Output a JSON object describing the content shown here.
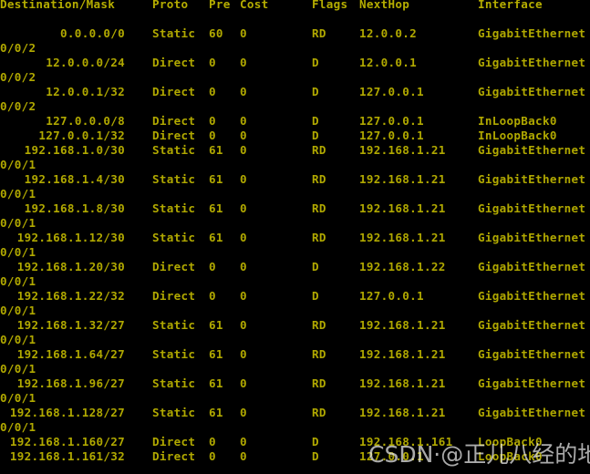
{
  "terminal": {
    "background_color": "#000000",
    "text_color": "#b0a800",
    "columns": {
      "destination": "Destination/Mask",
      "proto": "Proto",
      "pre": "Pre",
      "cost": "Cost",
      "flags": "Flags",
      "nexthop": "NextHop",
      "interface": "Interface"
    },
    "routes": [
      {
        "destination": "0.0.0.0/0",
        "proto": "Static",
        "pre": "60",
        "cost": "0",
        "flags": "RD",
        "nexthop": "12.0.0.2",
        "interface": "GigabitEthernet",
        "interface_wrap": "0/0/2"
      },
      {
        "destination": "12.0.0.0/24",
        "proto": "Direct",
        "pre": "0",
        "cost": "0",
        "flags": "D",
        "nexthop": "12.0.0.1",
        "interface": "GigabitEthernet",
        "interface_wrap": "0/0/2"
      },
      {
        "destination": "12.0.0.1/32",
        "proto": "Direct",
        "pre": "0",
        "cost": "0",
        "flags": "D",
        "nexthop": "127.0.0.1",
        "interface": "GigabitEthernet",
        "interface_wrap": "0/0/2"
      },
      {
        "destination": "127.0.0.0/8",
        "proto": "Direct",
        "pre": "0",
        "cost": "0",
        "flags": "D",
        "nexthop": "127.0.0.1",
        "interface": "InLoopBack0",
        "interface_wrap": ""
      },
      {
        "destination": "127.0.0.1/32",
        "proto": "Direct",
        "pre": "0",
        "cost": "0",
        "flags": "D",
        "nexthop": "127.0.0.1",
        "interface": "InLoopBack0",
        "interface_wrap": ""
      },
      {
        "destination": "192.168.1.0/30",
        "proto": "Static",
        "pre": "61",
        "cost": "0",
        "flags": "RD",
        "nexthop": "192.168.1.21",
        "interface": "GigabitEthernet",
        "interface_wrap": "0/0/1"
      },
      {
        "destination": "192.168.1.4/30",
        "proto": "Static",
        "pre": "61",
        "cost": "0",
        "flags": "RD",
        "nexthop": "192.168.1.21",
        "interface": "GigabitEthernet",
        "interface_wrap": "0/0/1"
      },
      {
        "destination": "192.168.1.8/30",
        "proto": "Static",
        "pre": "61",
        "cost": "0",
        "flags": "RD",
        "nexthop": "192.168.1.21",
        "interface": "GigabitEthernet",
        "interface_wrap": "0/0/1"
      },
      {
        "destination": "192.168.1.12/30",
        "proto": "Static",
        "pre": "61",
        "cost": "0",
        "flags": "RD",
        "nexthop": "192.168.1.21",
        "interface": "GigabitEthernet",
        "interface_wrap": "0/0/1"
      },
      {
        "destination": "192.168.1.20/30",
        "proto": "Direct",
        "pre": "0",
        "cost": "0",
        "flags": "D",
        "nexthop": "192.168.1.22",
        "interface": "GigabitEthernet",
        "interface_wrap": "0/0/1"
      },
      {
        "destination": "192.168.1.22/32",
        "proto": "Direct",
        "pre": "0",
        "cost": "0",
        "flags": "D",
        "nexthop": "127.0.0.1",
        "interface": "GigabitEthernet",
        "interface_wrap": "0/0/1"
      },
      {
        "destination": "192.168.1.32/27",
        "proto": "Static",
        "pre": "61",
        "cost": "0",
        "flags": "RD",
        "nexthop": "192.168.1.21",
        "interface": "GigabitEthernet",
        "interface_wrap": "0/0/1"
      },
      {
        "destination": "192.168.1.64/27",
        "proto": "Static",
        "pre": "61",
        "cost": "0",
        "flags": "RD",
        "nexthop": "192.168.1.21",
        "interface": "GigabitEthernet",
        "interface_wrap": "0/0/1"
      },
      {
        "destination": "192.168.1.96/27",
        "proto": "Static",
        "pre": "61",
        "cost": "0",
        "flags": "RD",
        "nexthop": "192.168.1.21",
        "interface": "GigabitEthernet",
        "interface_wrap": "0/0/1"
      },
      {
        "destination": "192.168.1.128/27",
        "proto": "Static",
        "pre": "61",
        "cost": "0",
        "flags": "RD",
        "nexthop": "192.168.1.21",
        "interface": "GigabitEthernet",
        "interface_wrap": "0/0/1"
      },
      {
        "destination": "192.168.1.160/27",
        "proto": "Direct",
        "pre": "0",
        "cost": "0",
        "flags": "D",
        "nexthop": "192.168.1.161",
        "interface": "LoopBack0",
        "interface_wrap": ""
      },
      {
        "destination": "192.168.1.161/32",
        "proto": "Direct",
        "pre": "0",
        "cost": "0",
        "flags": "D",
        "nexthop": "127.0.0.1",
        "interface": "LoopBack0",
        "interface_wrap": ""
      }
    ]
  },
  "watermark": {
    "text": "CSDN·@正儿八经的地球人"
  }
}
